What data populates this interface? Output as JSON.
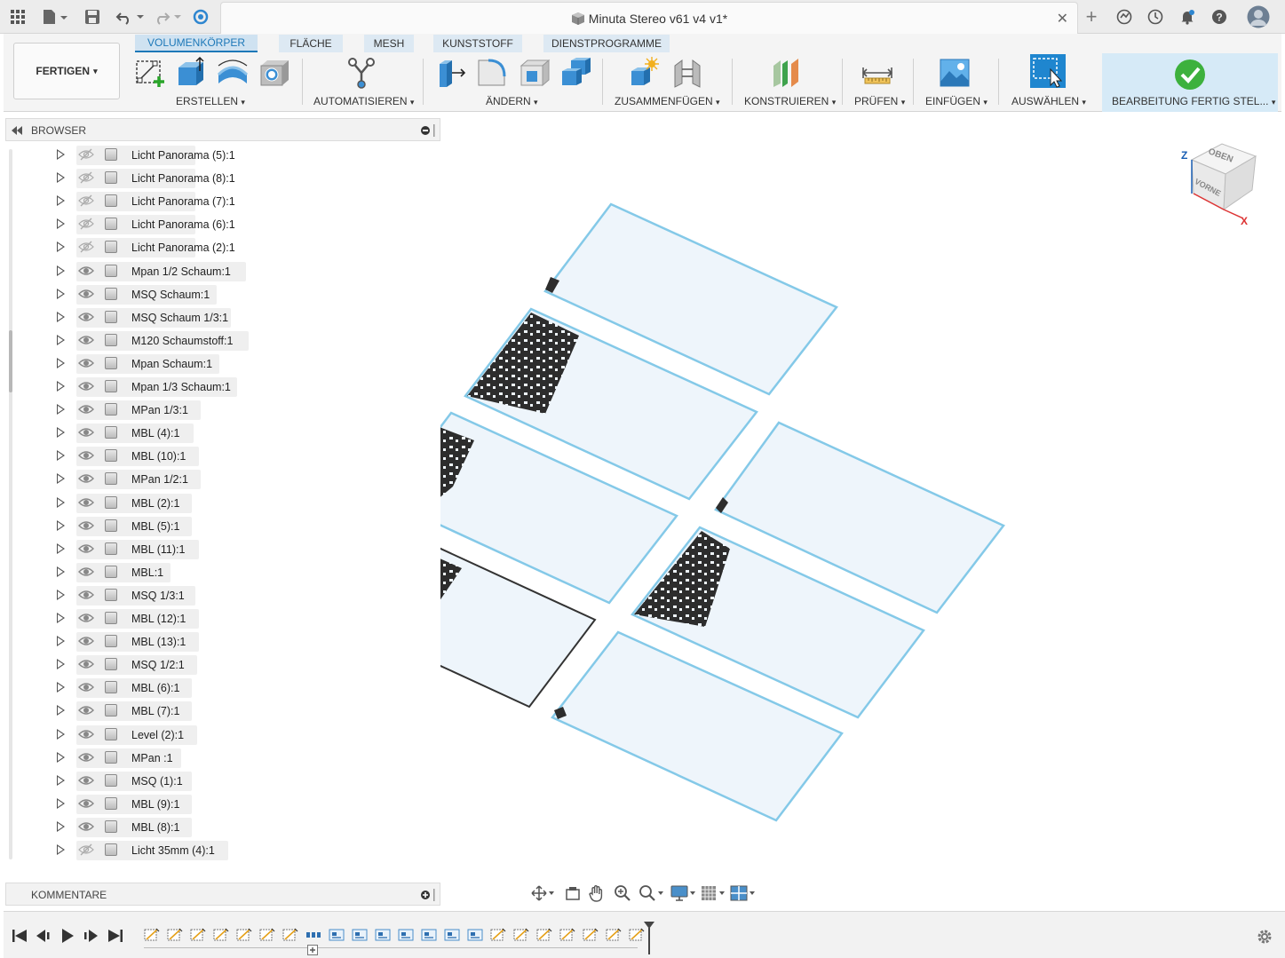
{
  "titlebar": {
    "doc_title": "Minuta Stereo v61 v4 v1*",
    "close_glyph": "✕",
    "plus_glyph": "+"
  },
  "ribbon": {
    "workspace": "FERTIGEN",
    "tabs": [
      "VOLUMENKÖRPER",
      "FLÄCHE",
      "MESH",
      "KUNSTSTOFF",
      "DIENSTPROGRAMME"
    ],
    "groups": {
      "create": "ERSTELLEN",
      "automate": "AUTOMATISIEREN",
      "modify": "ÄNDERN",
      "assemble": "ZUSAMMENFÜGEN",
      "construct": "KONSTRUIEREN",
      "inspect": "PRÜFEN",
      "insert": "EINFÜGEN",
      "select": "AUSWÄHLEN",
      "finish": "BEARBEITUNG FERTIG STEL..."
    },
    "dropdown_glyph": "▾",
    "accent_color": "#1d78b8"
  },
  "browser": {
    "title": "BROWSER",
    "items": [
      {
        "label": "Licht Panorama (5):1",
        "visible": false
      },
      {
        "label": "Licht Panorama (8):1",
        "visible": false
      },
      {
        "label": "Licht Panorama (7):1",
        "visible": false
      },
      {
        "label": "Licht Panorama (6):1",
        "visible": false
      },
      {
        "label": "Licht Panorama (2):1",
        "visible": false
      },
      {
        "label": "Mpan 1/2 Schaum:1",
        "visible": true
      },
      {
        "label": "MSQ Schaum:1",
        "visible": true
      },
      {
        "label": "MSQ Schaum 1/3:1",
        "visible": true
      },
      {
        "label": "M120 Schaumstoff:1",
        "visible": true
      },
      {
        "label": "Mpan Schaum:1",
        "visible": true
      },
      {
        "label": "Mpan 1/3 Schaum:1",
        "visible": true
      },
      {
        "label": "MPan 1/3:1",
        "visible": true
      },
      {
        "label": "MBL (4):1",
        "visible": true
      },
      {
        "label": "MBL (10):1",
        "visible": true
      },
      {
        "label": "MPan 1/2:1",
        "visible": true
      },
      {
        "label": "MBL (2):1",
        "visible": true
      },
      {
        "label": "MBL (5):1",
        "visible": true
      },
      {
        "label": "MBL (11):1",
        "visible": true
      },
      {
        "label": "MBL:1",
        "visible": true
      },
      {
        "label": "MSQ 1/3:1",
        "visible": true
      },
      {
        "label": "MBL (12):1",
        "visible": true
      },
      {
        "label": "MBL (13):1",
        "visible": true
      },
      {
        "label": "MSQ 1/2:1",
        "visible": true
      },
      {
        "label": "MBL (6):1",
        "visible": true
      },
      {
        "label": "MBL (7):1",
        "visible": true
      },
      {
        "label": "Level (2):1",
        "visible": true
      },
      {
        "label": "MPan :1",
        "visible": true
      },
      {
        "label": "MSQ (1):1",
        "visible": true
      },
      {
        "label": "MBL (9):1",
        "visible": true
      },
      {
        "label": "MBL (8):1",
        "visible": true
      },
      {
        "label": "Licht 35mm (4):1",
        "visible": false
      }
    ]
  },
  "comments": {
    "title": "KOMMENTARE"
  },
  "viewcube": {
    "top": "OBEN",
    "front": "VORNE",
    "axis_z": "Z",
    "axis_x": "X"
  },
  "timeline": {
    "feature_count": 22
  }
}
